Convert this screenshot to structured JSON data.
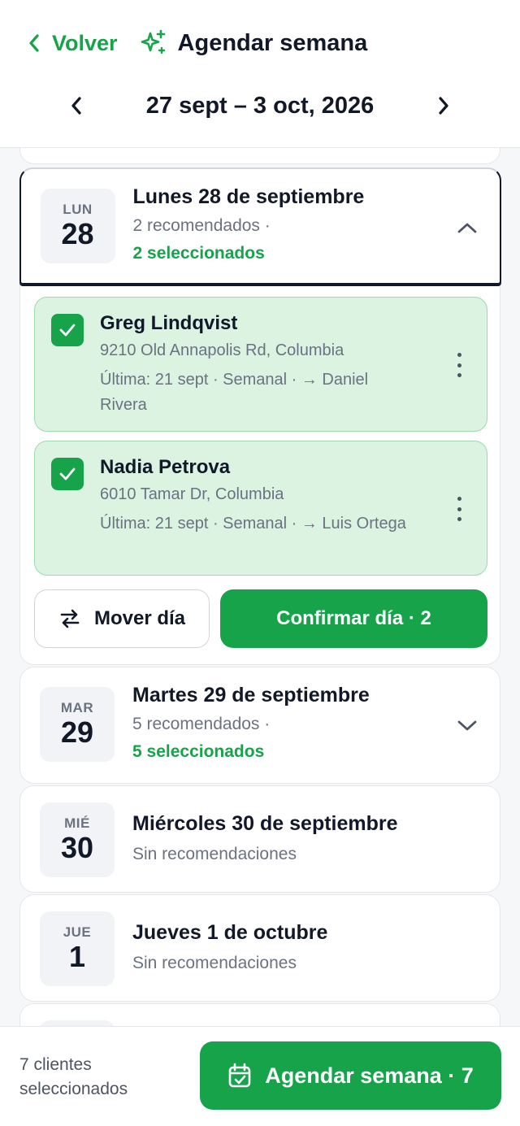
{
  "header": {
    "back_label": "Volver",
    "title": "Agendar semana",
    "week_range": "27 sept – 3 oct, 2026"
  },
  "days": [
    {
      "dow": "LUN",
      "num": "28",
      "title": "Lunes 28 de septiembre",
      "recommended": "2 recomendados ·",
      "selected": "2 seleccionados",
      "expanded": true,
      "clients": [
        {
          "name": "Greg Lindqvist",
          "address": "9210 Old Annapolis Rd, Columbia",
          "meta": "Última: 21 sept · Semanal · → Daniel Rivera",
          "checked": true
        },
        {
          "name": "Nadia Petrova",
          "address": "6010 Tamar Dr, Columbia",
          "meta": "Última: 21 sept · Semanal · → Luis Ortega",
          "checked": true
        }
      ],
      "move_label": "Mover día",
      "confirm_label": "Confirmar día · 2"
    },
    {
      "dow": "MAR",
      "num": "29",
      "title": "Martes 29 de septiembre",
      "recommended": "5 recomendados ·",
      "selected": "5 seleccionados",
      "expanded": false
    },
    {
      "dow": "MIÉ",
      "num": "30",
      "title": "Miércoles 30 de septiembre",
      "recommended": "Sin recomendaciones"
    },
    {
      "dow": "JUE",
      "num": "1",
      "title": "Jueves 1 de octubre",
      "recommended": "Sin recomendaciones"
    }
  ],
  "footer": {
    "count": "7 clientes seleccionados",
    "schedule_label": "Agendar semana · 7"
  },
  "colors": {
    "accent": "#16a34a",
    "selected_bg": "#dcf3e2",
    "selected_border": "#9fd9ae",
    "text": "#111827",
    "muted": "#6b7280"
  }
}
